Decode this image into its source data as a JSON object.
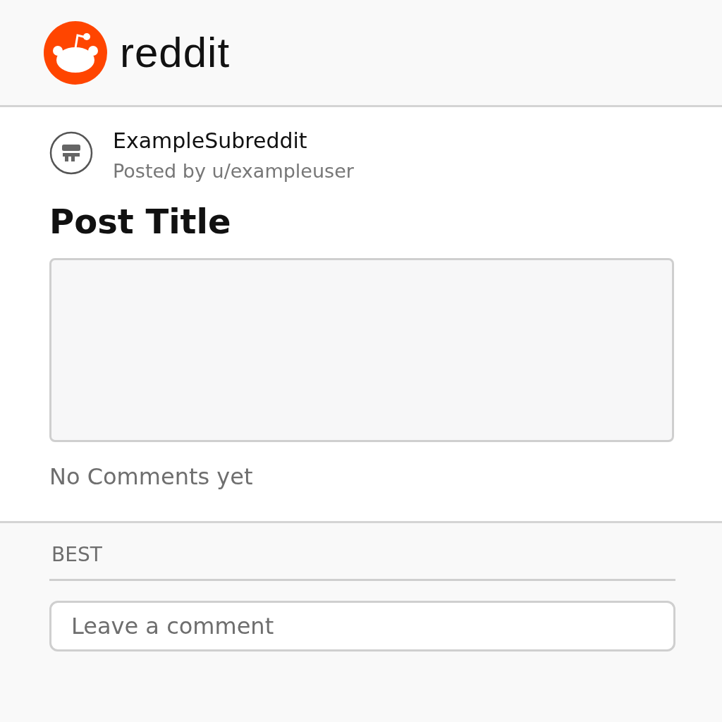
{
  "header": {
    "brand": "reddit"
  },
  "post": {
    "subreddit": "ExampleSubreddit",
    "posted_by": "Posted by u/exampleuser",
    "title": "Post Title",
    "comments_status": "No Comments yet"
  },
  "comments": {
    "sort": "BEST",
    "input": {
      "placeholder": "Leave a comment"
    }
  }
}
